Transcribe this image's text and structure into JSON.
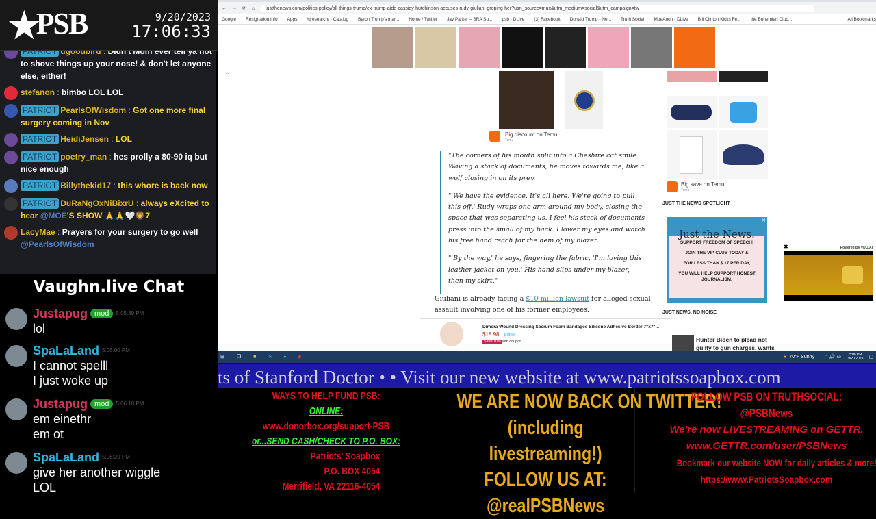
{
  "overlay": {
    "logo": "PSB",
    "date": "9/20/2023",
    "time": "17:06:33"
  },
  "chat1": [
    {
      "badge": "PATRIOT",
      "user": "ugoodbird",
      "text": "Didn't Mom ever tell ya not to shove things up your nose! & don't let anyone else, either!",
      "avatar": "#6b4a9a"
    },
    {
      "badge": "",
      "user": "stefanon",
      "text": "bimbo LOL LOL",
      "avatar": "#e02a3a"
    },
    {
      "badge": "PATRIOT",
      "user": "PearlsOfWisdom",
      "text": "Got one more final surgery coming in Nov",
      "avatar": "#3658b0",
      "yellow": true
    },
    {
      "badge": "PATRIOT",
      "user": "HeidiJensen",
      "text": "LOL",
      "avatar": "#6b4a9a",
      "yellow": true
    },
    {
      "badge": "PATRIOT",
      "user": "poetry_man",
      "text": "hes prolly a 80-90 iq but nice enough",
      "avatar": "#6b4a9a"
    },
    {
      "badge": "PATRIOT",
      "user": "Billythekid17",
      "text": "this whore is back now",
      "avatar": "#5a7ac0",
      "yellow": true
    },
    {
      "badge": "PATRIOT",
      "user": "DuRaNgOxNiBixrU",
      "text": "always eXcited to hear",
      "mention": "@MOE",
      "text2": "'S SHOW 🙏🙏🤍🦁7",
      "avatar": "#333",
      "yellow": true
    },
    {
      "badge": "",
      "user": "LacyMae",
      "text": "Prayers for your surgery to go well",
      "mention": "@PearlsOfWisdom",
      "avatar": "#b03a2a"
    }
  ],
  "vaughn": {
    "title": "Vaughn.live Chat",
    "messages": [
      {
        "user": "Justapug",
        "mod": "mod",
        "time": "5:05:39 PM",
        "lines": [
          "lol"
        ],
        "color": "#d23a5a"
      },
      {
        "user": "SpaLaLand",
        "mod": "",
        "time": "5:06:00 PM",
        "lines": [
          "I cannot spelll",
          "I just woke up"
        ],
        "color": "#2fb6e0"
      },
      {
        "user": "Justapug",
        "mod": "mod",
        "time": "5:06:18 PM",
        "lines": [
          "em einethr",
          "em ot"
        ],
        "color": "#d23a5a"
      },
      {
        "user": "SpaLaLand",
        "mod": "",
        "time": "5:06:29 PM",
        "lines": [
          "give her another wiggle",
          "LOL"
        ],
        "color": "#2fb6e0"
      }
    ]
  },
  "browser": {
    "url": "justthenews.com/politics-policy/all-things-trump/ex-trump-aide-cassidy-hutchinson-accuses-rudy-giuliani-groping-her?utm_source=mux&utm_medium=social&utm_campaign=tw",
    "bookmarks": [
      "Google",
      "Resignation.info",
      "Apps",
      "/qresearch/ - Catalog",
      "Baron Trump's mar...",
      "Home / Twitter",
      "Jay Parker – SRA Su...",
      "psb · DLive",
      "(3) Facebook",
      "Donald Trump - Ne...",
      "Truth Social",
      "MoeAnon - DLive",
      "Bill Clinton Kicks Fe...",
      "the Bohemian Club...",
      "All Bookmarks"
    ],
    "ad1": "Big discount on Temu",
    "ad1_src": "Temu",
    "quotes": [
      "\"The corners of his mouth split into a Cheshire cat smile. Waving a stack of documents, he moves towards me, like a wolf closing in on its prey.",
      "\"'We have the evidence. It's all here. We're going to pull this off.' Rudy wraps one arm around my body, closing the space that was separating us. I feel his stack of documents press into the small of my back. I lower my eyes and watch his free hand reach for the hem of my blazer.",
      "\"'By the way,' he says, fingering the fabric, 'I'm loving this leather jacket on you.' His hand slips under my blazer, then my skirt.\""
    ],
    "para_pre": "Giuliani is already facing a ",
    "para_link": "$10 million lawsuit",
    "para_post": " for alleged sexual assault involving one of his former employees.",
    "amazon": {
      "title": "Dimora Wound Dressing Sacrum Foam Bandages Silicone Adhesive Border 7\"x7\"...",
      "price": "$18.98",
      "prime": "prime",
      "save": "Save 10%",
      "coupon": "with coupon"
    },
    "ad2": "Big save on Temu",
    "ad2_src": "Temu",
    "spotlight": "JUST THE NEWS SPOTLIGHT",
    "jtn": {
      "logo": "Just the News.",
      "l1": "SUPPORT FREEDOM OF SPEECH!",
      "l2": "JOIN THE VIP CLUB TODAY &",
      "l3": "FOR LESS THAN $.17 PER DAY,",
      "l4": "YOU WILL HELP SUPPORT HONEST JOURNALISM."
    },
    "noise": "JUST NEWS, NO NOISE",
    "headline": "Hunter Biden to plead not guilty to gun charges, wants",
    "vdo": "Powered By VDO.AI"
  },
  "taskbar": {
    "weather": "70°F Sunny",
    "clock": "5:06 PM",
    "date": "9/20/2023"
  },
  "ticker": "ts of Stanford Doctor   •      •   Visit our new website at www.patriotssoapbox.com",
  "panel_left": {
    "h": "WAYS TO HELP FUND PSB:",
    "online": "ONLINE:",
    "url": "www.donorbox.org/support-PSB",
    "mail": "or...SEND CASH/CHECK TO P.O. BOX:",
    "a1": "Patriots' Soapbox",
    "a2": "P.O. BOX 4054",
    "a3": "Merrifield, VA 22116-4054"
  },
  "panel_mid": {
    "l1": "WE ARE NOW BACK ON TWITTER!",
    "l2": "(including livestreaming!)",
    "l3": "FOLLOW US AT:",
    "l4": "@realPSBNews"
  },
  "panel_right": {
    "l1": "FOLLOW PSB ON TRUTHSOCIAL:",
    "l2": "@PSBNews",
    "l3": "We're now LIVESTREAMING on GETTR.",
    "l4": "www.GETTR.com/user/PSBNews",
    "l5": "Bookmark our website NOW for daily articles & more!",
    "l6": "https://www.PatriotsSoapbox.com"
  }
}
